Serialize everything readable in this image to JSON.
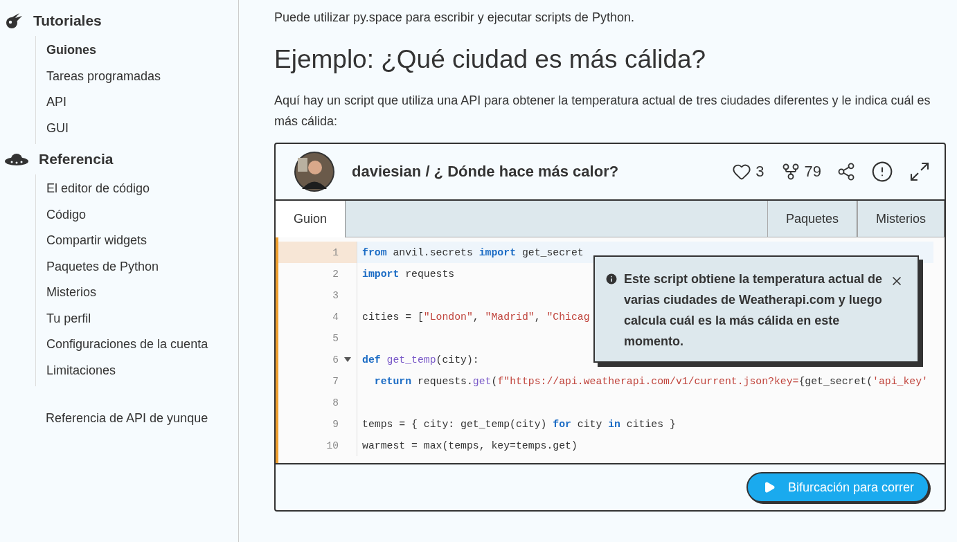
{
  "sidebar": {
    "sections": [
      {
        "kind": "tutorials",
        "title": "Tutoriales",
        "items": [
          {
            "label": "Guiones",
            "selected": true
          },
          {
            "label": "Tareas programadas",
            "selected": false
          },
          {
            "label": "API",
            "selected": false
          },
          {
            "label": "GUI",
            "selected": false
          }
        ]
      },
      {
        "kind": "reference",
        "title": "Referencia",
        "items": [
          {
            "label": "El editor de código",
            "selected": false
          },
          {
            "label": "Código",
            "selected": false
          },
          {
            "label": "Compartir widgets",
            "selected": false
          },
          {
            "label": "Paquetes de Python",
            "selected": false
          },
          {
            "label": "Misterios",
            "selected": false
          },
          {
            "label": "Tu perfil",
            "selected": false
          },
          {
            "label": "Configuraciones de la cuenta",
            "selected": false
          },
          {
            "label": "Limitaciones",
            "selected": false
          }
        ]
      }
    ],
    "extra_link": "Referencia de API de yunque"
  },
  "intro": "Puede utilizar py.space para escribir y ejecutar scripts de Python.",
  "heading": "Ejemplo: ¿Qué ciudad es más cálida?",
  "paragraph": "Aquí hay un script que utiliza una API para obtener la temperatura actual de tres ciudades diferentes y le indica cuál es más cálida:",
  "embed": {
    "title": "daviesian / ¿ Dónde hace más calor?",
    "likes": "3",
    "forks": "79",
    "tabs": [
      {
        "label": "Guion",
        "selected": true
      },
      {
        "label": "Paquetes",
        "selected": false
      },
      {
        "label": "Misterios",
        "selected": false
      }
    ],
    "code": [
      {
        "number": "1",
        "active": true,
        "foldable": false,
        "tokens": [
          {
            "kind": "kw",
            "text": "from"
          },
          {
            "kind": "plain",
            "text": " anvil.secrets "
          },
          {
            "kind": "kw",
            "text": "import"
          },
          {
            "kind": "plain",
            "text": " get_secret"
          }
        ]
      },
      {
        "number": "2",
        "active": false,
        "foldable": false,
        "tokens": [
          {
            "kind": "kw",
            "text": "import"
          },
          {
            "kind": "plain",
            "text": " requests"
          }
        ]
      },
      {
        "number": "3",
        "active": false,
        "foldable": false
      },
      {
        "number": "4",
        "active": false,
        "foldable": false,
        "tokens": [
          {
            "kind": "plain",
            "text": "cities = ["
          },
          {
            "kind": "str",
            "text": "\"London\""
          },
          {
            "kind": "plain",
            "text": ", "
          },
          {
            "kind": "str",
            "text": "\"Madrid\""
          },
          {
            "kind": "plain",
            "text": ", "
          },
          {
            "kind": "str",
            "text": "\"Chicag"
          }
        ]
      },
      {
        "number": "5",
        "active": false,
        "foldable": false
      },
      {
        "number": "6",
        "active": false,
        "foldable": true,
        "tokens": [
          {
            "kind": "kw",
            "text": "def"
          },
          {
            "kind": "fn",
            "text": " get_temp"
          },
          {
            "kind": "plain",
            "text": "(city):"
          }
        ]
      },
      {
        "number": "7",
        "active": false,
        "foldable": false,
        "tokens": [
          {
            "kind": "kw",
            "text": "  return"
          },
          {
            "kind": "plain",
            "text": " requests."
          },
          {
            "kind": "fn",
            "text": "get"
          },
          {
            "kind": "plain",
            "text": "("
          },
          {
            "kind": "str",
            "text": "f\"https://api.weatherapi.com/v1/current.json?key="
          },
          {
            "kind": "plain",
            "text": "{get_secret("
          },
          {
            "kind": "str",
            "text": "'api_key'"
          }
        ]
      },
      {
        "number": "8",
        "active": false,
        "foldable": false
      },
      {
        "number": "9",
        "active": false,
        "foldable": false,
        "tokens": [
          {
            "kind": "plain",
            "text": "temps = { city: get_temp(city) "
          },
          {
            "kind": "kw",
            "text": "for"
          },
          {
            "kind": "plain",
            "text": " city "
          },
          {
            "kind": "kw",
            "text": "in"
          },
          {
            "kind": "plain",
            "text": " cities }"
          }
        ]
      },
      {
        "number": "10",
        "active": false,
        "foldable": false,
        "tokens": [
          {
            "kind": "plain",
            "text": "warmest = max(temps, key=temps.get)"
          }
        ]
      }
    ],
    "tooltip": "Este script obtiene la temperatura actual de varias ciudades de Weatherapi.com y luego calcula cuál es la más cálida en este momento.",
    "button": "Bifurcación para correr"
  }
}
